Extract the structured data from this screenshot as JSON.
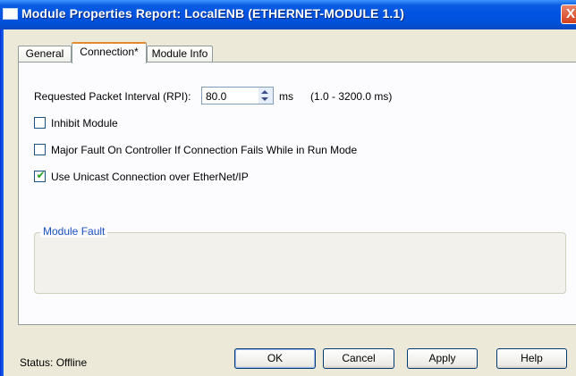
{
  "window": {
    "title": "Module Properties Report: LocalENB (ETHERNET-MODULE 1.1)",
    "close_label": "X"
  },
  "tabs": [
    {
      "label": "General",
      "active": false
    },
    {
      "label": "Connection*",
      "active": true
    },
    {
      "label": "Module Info",
      "active": false
    }
  ],
  "connection": {
    "rpi_label": "Requested Packet Interval (RPI):",
    "rpi_value": "80.0",
    "rpi_unit": "ms",
    "rpi_range": "(1.0 - 3200.0 ms)",
    "checks": [
      {
        "label": "Inhibit Module",
        "checked": false
      },
      {
        "label": "Major Fault On Controller If Connection Fails While in Run Mode",
        "checked": false
      },
      {
        "label": "Use Unicast Connection over EtherNet/IP",
        "checked": true
      }
    ],
    "module_fault_title": "Module Fault"
  },
  "status": {
    "text": "Status:  Offline"
  },
  "buttons": {
    "ok": "OK",
    "cancel": "Cancel",
    "apply": "Apply",
    "help": "Help"
  },
  "colors": {
    "title_bar": "#0054e3",
    "active_tab_accent": "#e68b2c",
    "group_title": "#1a4fc0",
    "check_mark": "#21a121"
  }
}
